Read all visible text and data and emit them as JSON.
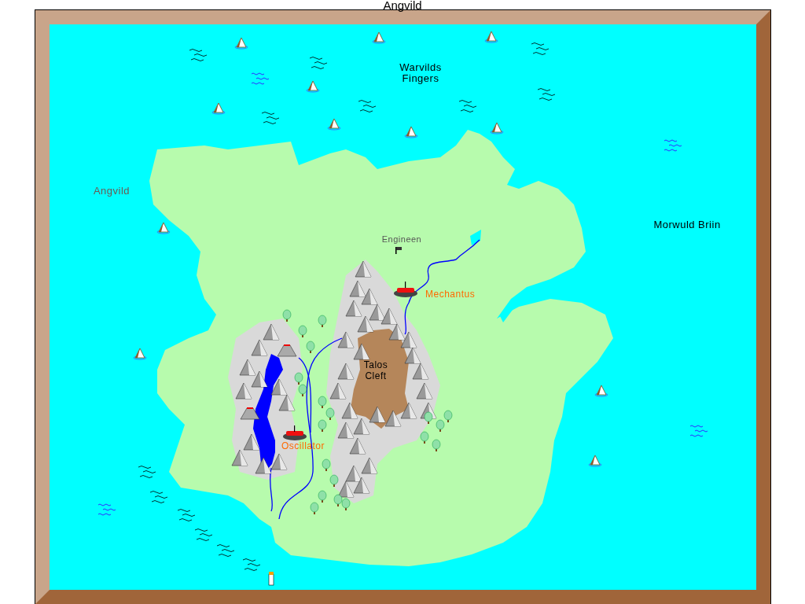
{
  "title": "Angvild",
  "map": {
    "labels": [
      {
        "lines": [
          "Warvilds",
          "Fingers"
        ],
        "kind": "sea"
      },
      {
        "lines": [
          "Angvild"
        ],
        "kind": "region"
      },
      {
        "lines": [
          "Morwuld Briin"
        ],
        "kind": "sea"
      },
      {
        "lines": [
          "Engineen"
        ],
        "kind": "village"
      },
      {
        "lines": [
          "Mechantus"
        ],
        "kind": "town"
      },
      {
        "lines": [
          "Talos",
          "Cleft"
        ],
        "kind": "terrain"
      },
      {
        "lines": [
          "Oscillator"
        ],
        "kind": "town"
      }
    ]
  }
}
